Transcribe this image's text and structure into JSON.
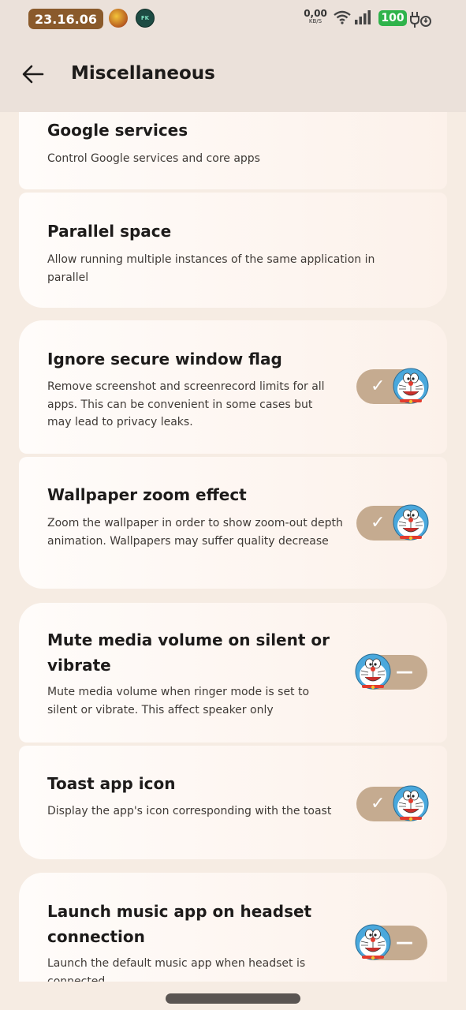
{
  "status_bar": {
    "time": "23.16.06",
    "net_speed_value": "0,00",
    "net_speed_unit": "KB/S",
    "battery_level": "100",
    "avatar2_text": "FK"
  },
  "app_bar": {
    "title": "Miscellaneous"
  },
  "settings": [
    {
      "title": "Google services",
      "description": "Control Google services and core apps"
    },
    {
      "title": "Parallel space",
      "description": "Allow running multiple instances of the same application in parallel"
    },
    {
      "title": "Ignore secure window flag",
      "description": "Remove screenshot and screenrecord limits for all apps. This can be convenient in some cases but may lead to privacy leaks.",
      "enabled": true
    },
    {
      "title": "Wallpaper zoom effect",
      "description": "Zoom the wallpaper in order to show zoom-out depth animation. Wallpapers may suffer quality decrease",
      "enabled": true
    },
    {
      "title": "Mute media volume on silent or vibrate",
      "description": "Mute media volume when ringer mode is set to silent or vibrate. This affect speaker only",
      "enabled": false
    },
    {
      "title": "Toast app icon",
      "description": "Display the app's icon corresponding with the toast",
      "enabled": true
    },
    {
      "title": "Launch music app on headset connection",
      "description": "Launch the default music app when headset is connected",
      "enabled": false
    }
  ],
  "toggle_marks": {
    "on": "✓",
    "off": "—"
  },
  "icons": {
    "back": "arrow-left-icon",
    "wifi": "wifi-icon",
    "signal": "signal-icon",
    "charging": "charging-plug-icon",
    "thumb": "doraemon-face-icon"
  },
  "colors": {
    "background": "#f6ece3",
    "app_bar": "#ebe1da",
    "toggle_track": "#c5ab90",
    "time_pill": "#8a5a2b",
    "battery": "#2fb34b"
  }
}
